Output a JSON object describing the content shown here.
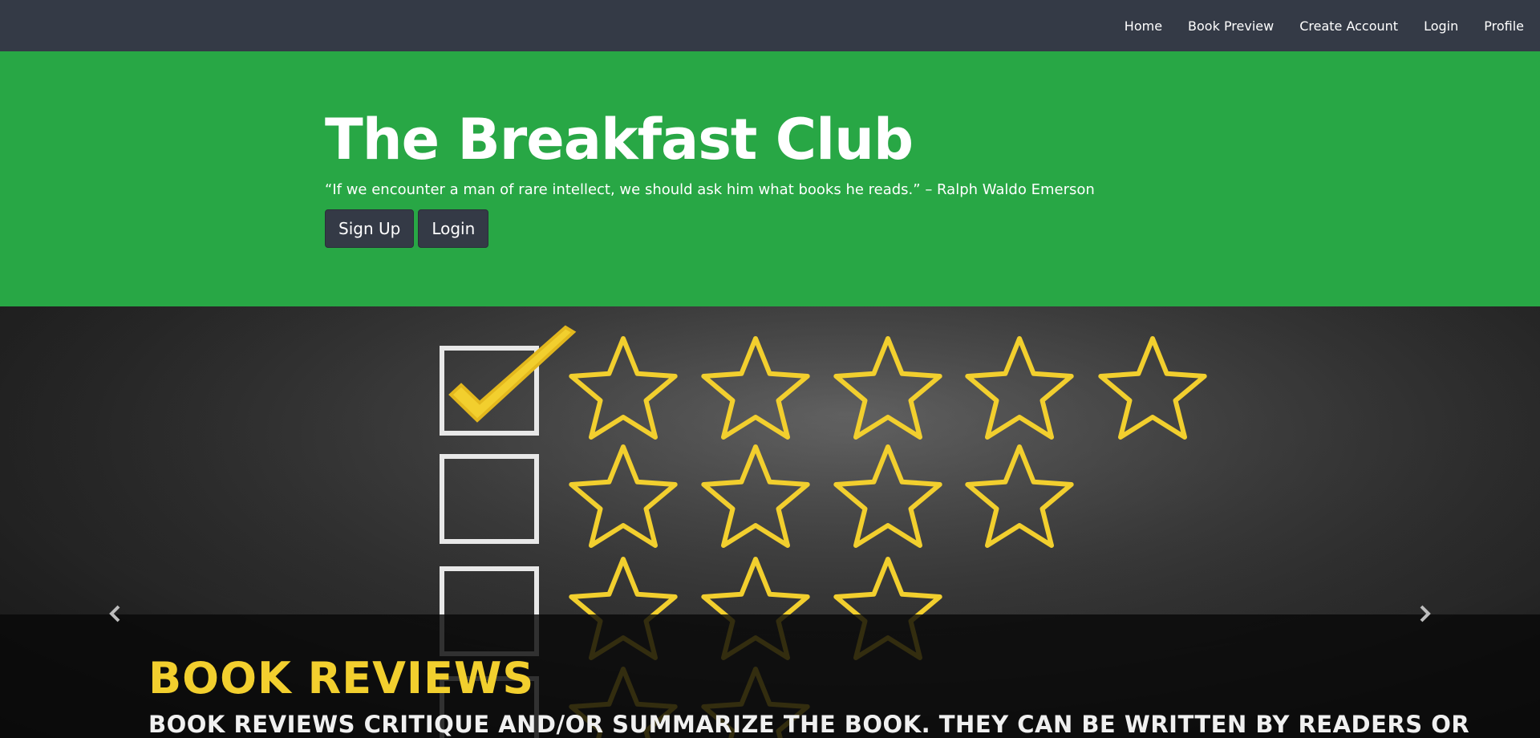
{
  "nav": {
    "items": [
      {
        "label": "Home"
      },
      {
        "label": "Book Preview"
      },
      {
        "label": "Create Account"
      },
      {
        "label": "Login"
      },
      {
        "label": "Profile"
      }
    ]
  },
  "hero": {
    "title": "The Breakfast Club",
    "quote": "“If we encounter a man of rare intellect, we should ask him what books he reads.” – Ralph Waldo Emerson",
    "signup_label": "Sign Up",
    "login_label": "Login"
  },
  "carousel": {
    "slide_title": "BOOK REVIEWS",
    "slide_text": "BOOK REVIEWS CRITIQUE AND/OR SUMMARIZE THE BOOK. THEY CAN BE WRITTEN BY READERS OR",
    "prev_icon": "chevron-left-icon",
    "next_icon": "chevron-right-icon"
  },
  "colors": {
    "navbar": "#343a46",
    "hero": "#28a745",
    "accent_yellow": "#f2cf2e",
    "button": "#343a46"
  }
}
